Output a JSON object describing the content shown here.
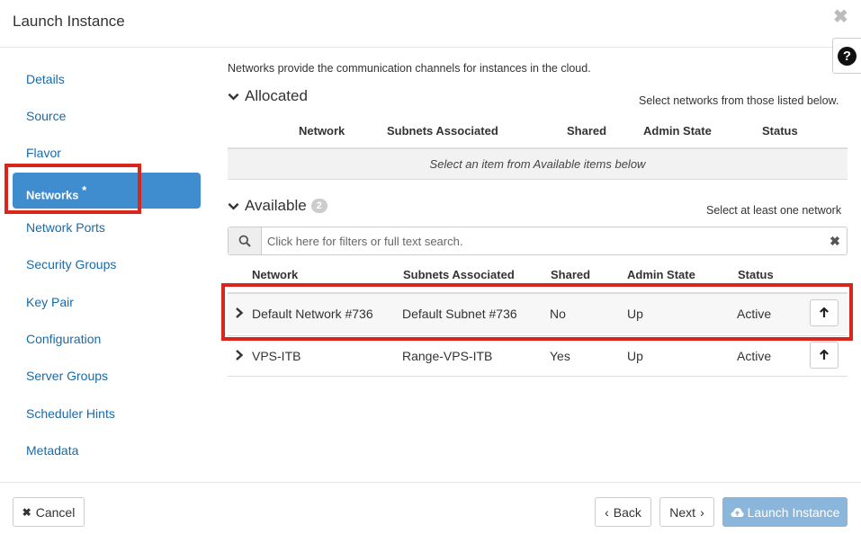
{
  "modal": {
    "title": "Launch Instance",
    "close_glyph": "✖",
    "help_glyph": "?"
  },
  "sidebar": {
    "items": [
      {
        "label": "Details"
      },
      {
        "label": "Source"
      },
      {
        "label": "Flavor"
      },
      {
        "label": "Networks",
        "required_mark": "*",
        "active": true
      },
      {
        "label": "Network Ports"
      },
      {
        "label": "Security Groups"
      },
      {
        "label": "Key Pair"
      },
      {
        "label": "Configuration"
      },
      {
        "label": "Server Groups"
      },
      {
        "label": "Scheduler Hints"
      },
      {
        "label": "Metadata"
      }
    ]
  },
  "main": {
    "intro": "Networks provide the communication channels for instances in the cloud.",
    "allocated": {
      "title": "Allocated",
      "hint": "Select networks from those listed below.",
      "columns": [
        "Network",
        "Subnets Associated",
        "Shared",
        "Admin State",
        "Status"
      ],
      "empty_message": "Select an item from Available items below"
    },
    "available": {
      "title": "Available",
      "count": "2",
      "hint": "Select at least one network",
      "search_placeholder": "Click here for filters or full text search.",
      "columns": [
        "Network",
        "Subnets Associated",
        "Shared",
        "Admin State",
        "Status"
      ],
      "rows": [
        {
          "network": "Default Network #736",
          "subnet": "Default Subnet #736",
          "shared": "No",
          "admin_state": "Up",
          "status": "Active"
        },
        {
          "network": "VPS-ITB",
          "subnet": "Range-VPS-ITB",
          "shared": "Yes",
          "admin_state": "Up",
          "status": "Active"
        }
      ]
    }
  },
  "footer": {
    "cancel_label": "Cancel",
    "back_label": "Back",
    "next_label": "Next",
    "launch_label": "Launch Instance"
  },
  "colors": {
    "accent": "#3f8ccf",
    "highlight_red": "#d9251c",
    "link": "#1a6aa7",
    "launch_disabled": "#8ab6dc"
  },
  "icons": [
    "close-icon",
    "help-icon",
    "chevron-down-icon",
    "search-icon",
    "clear-icon",
    "chevron-right-icon",
    "arrow-up-icon",
    "times-icon",
    "cloud-upload-icon"
  ]
}
